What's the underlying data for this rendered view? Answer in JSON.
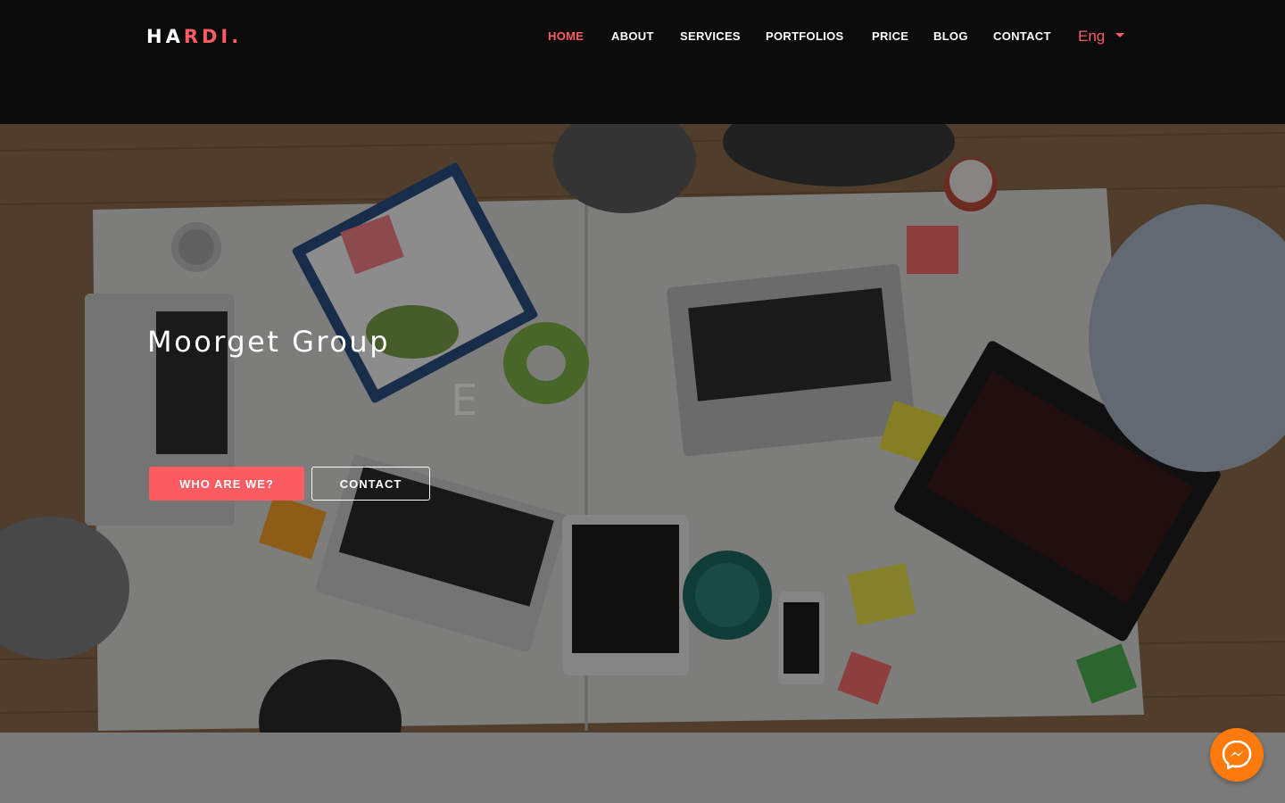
{
  "header": {
    "logo": {
      "part1": "HA",
      "part2": "RDI",
      "part3": "."
    },
    "nav": [
      {
        "label": "HOME",
        "active": true
      },
      {
        "label": "ABOUT",
        "active": false
      },
      {
        "label": "SERVICES",
        "active": false
      },
      {
        "label": "PORTFOLIOS",
        "active": false
      },
      {
        "label": "PRICE",
        "active": false
      },
      {
        "label": "BLOG",
        "active": false
      },
      {
        "label": "CONTACT",
        "active": false
      }
    ],
    "language": "Eng"
  },
  "hero": {
    "title": "Moorget Group",
    "ghost_letter": "E",
    "primary_button": "WHO ARE WE?",
    "secondary_button": "CONTACT",
    "background_image": "overhead-office-desk-with-laptops"
  },
  "messenger": {
    "icon": "messenger-icon"
  },
  "colors": {
    "accent": "#fb5c62",
    "header_bg": "#0b0b0c",
    "messenger": "#ff7a0c",
    "footer_strip": "#7b7b7b"
  }
}
